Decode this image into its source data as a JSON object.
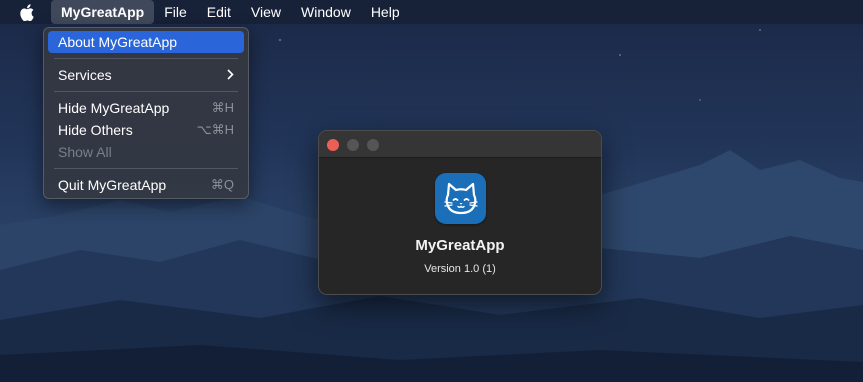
{
  "menubar": {
    "items": [
      {
        "label": "MyGreatApp"
      },
      {
        "label": "File"
      },
      {
        "label": "Edit"
      },
      {
        "label": "View"
      },
      {
        "label": "Window"
      },
      {
        "label": "Help"
      }
    ]
  },
  "app_menu": {
    "items": [
      {
        "label": "About MyGreatApp",
        "shortcut": "",
        "highlighted": true
      },
      {
        "label": "Services",
        "shortcut": ""
      },
      {
        "label": "Hide MyGreatApp",
        "shortcut": "⌘H"
      },
      {
        "label": "Hide Others",
        "shortcut": "⌥⌘H"
      },
      {
        "label": "Show All",
        "shortcut": "",
        "disabled": true
      },
      {
        "label": "Quit MyGreatApp",
        "shortcut": "⌘Q"
      }
    ]
  },
  "about_window": {
    "app_name": "MyGreatApp",
    "version": "Version 1.0 (1)",
    "icon": "cat-face-icon"
  },
  "colors": {
    "highlight": "#2a66d9",
    "icon_bg": "#1a6fb8",
    "close_button": "#ec5f57"
  }
}
